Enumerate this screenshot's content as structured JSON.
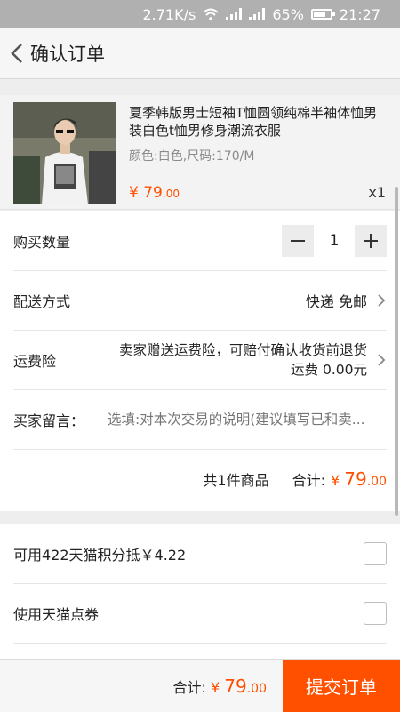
{
  "status_bar": {
    "speed": "2.71K/s",
    "battery": "65%",
    "time": "21:27"
  },
  "header": {
    "title": "确认订单"
  },
  "product": {
    "title": "夏季韩版男士短袖T恤圆领纯棉半袖体恤男装白色t恤男修身潮流衣服",
    "spec": "颜色:白色,尺码:170/M",
    "price_symbol": "¥",
    "price_int": "79",
    "price_dec": ".00",
    "qty": "x1"
  },
  "quantity": {
    "label": "购买数量",
    "value": "1"
  },
  "delivery": {
    "label": "配送方式",
    "value": "快递 免邮"
  },
  "insurance": {
    "label": "运费险",
    "line1": "卖家赠送运费险，可赔付确认收货前退货",
    "line2": "运费 0.00元"
  },
  "message": {
    "label": "买家留言：",
    "placeholder": "选填:对本次交易的说明(建议填写已和卖..."
  },
  "summary": {
    "count": "共1件商品",
    "total_label": "合计:",
    "symbol": "¥",
    "int": "79",
    "dec": ".00"
  },
  "options": [
    {
      "label": "可用422天猫积分抵￥4.22"
    },
    {
      "label": "使用天猫点券"
    }
  ],
  "bottom": {
    "total_label": "合计:",
    "symbol": "¥",
    "int": "79",
    "dec": ".00",
    "submit": "提交订单"
  }
}
